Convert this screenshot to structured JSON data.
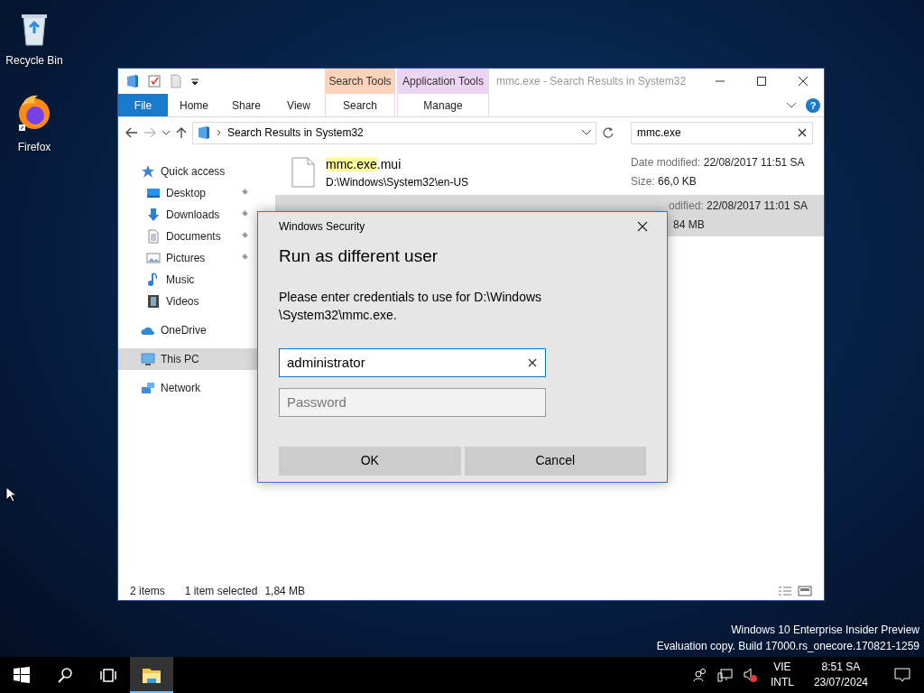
{
  "desktop_icons": [
    {
      "label": "Recycle Bin",
      "kind": "recycle"
    },
    {
      "label": "Firefox",
      "kind": "firefox"
    }
  ],
  "explorer": {
    "title": "mmc.exe - Search Results in System32",
    "contextual_tabs": [
      {
        "group": "Search Tools",
        "tab": "Search",
        "color": "#fbd3bb"
      },
      {
        "group": "Application Tools",
        "tab": "Manage",
        "color": "#ecd5f3"
      }
    ],
    "ribbon_tabs": [
      {
        "label": "File",
        "kind": "file"
      },
      {
        "label": "Home",
        "kind": "tab"
      },
      {
        "label": "Share",
        "kind": "tab"
      },
      {
        "label": "View",
        "kind": "tab"
      }
    ],
    "help": "?",
    "address": "Search Results in System32",
    "search": "mmc.exe",
    "nav": [
      {
        "label": "Quick access",
        "kind": "star",
        "selected": false,
        "children": [
          {
            "label": "Desktop",
            "kind": "desktop",
            "pinned": true,
            "selected": false
          },
          {
            "label": "Downloads",
            "kind": "download",
            "pinned": true,
            "selected": false
          },
          {
            "label": "Documents",
            "kind": "document",
            "pinned": true,
            "selected": false
          },
          {
            "label": "Pictures",
            "kind": "pictures",
            "pinned": true,
            "selected": false
          },
          {
            "label": "Music",
            "kind": "music",
            "pinned": false,
            "selected": false
          },
          {
            "label": "Videos",
            "kind": "videos",
            "pinned": false,
            "selected": false
          }
        ]
      },
      {
        "label": "OneDrive",
        "kind": "cloud",
        "selected": false
      },
      {
        "label": "This PC",
        "kind": "pc",
        "selected": true
      },
      {
        "label": "Network",
        "kind": "network",
        "selected": false
      }
    ],
    "results": [
      {
        "kind": "full",
        "selected": false,
        "name_parts": [
          {
            "text": "mmc.exe",
            "highlight": true
          },
          {
            "text": ".mui",
            "highlight": false
          }
        ],
        "path": "D:\\Windows\\System32\\en-US",
        "date_label": "Date modified:",
        "date": "22/08/2017 11:51 SA",
        "size_label": "Size:",
        "size": "66,0 KB"
      },
      {
        "kind": "covered",
        "selected": true,
        "date_label": "odified:",
        "date": "22/08/2017 11:01 SA",
        "size": "84 MB"
      }
    ],
    "status": {
      "items": "2 items",
      "selected": "1 item selected",
      "size": "1,84 MB"
    }
  },
  "dialog": {
    "caption": "Windows Security",
    "title": "Run as different user",
    "message": "Please enter credentials to use for D:\\Windows\n\\System32\\mmc.exe.",
    "username": "administrator",
    "username_focused": true,
    "password_placeholder": "Password",
    "buttons": [
      "OK",
      "Cancel"
    ]
  },
  "watermark": [
    "Windows 10 Enterprise Insider Preview",
    "Evaluation copy. Build 17000.rs_onecore.170821-1259"
  ],
  "taskbar": {
    "items": [
      {
        "kind": "start",
        "active": false
      },
      {
        "kind": "search",
        "active": false
      },
      {
        "kind": "taskview",
        "active": false
      },
      {
        "kind": "explorer",
        "active": true
      }
    ],
    "language": [
      "VIE",
      "INTL"
    ],
    "time": "8:51 SA",
    "date": "23/07/2024"
  }
}
